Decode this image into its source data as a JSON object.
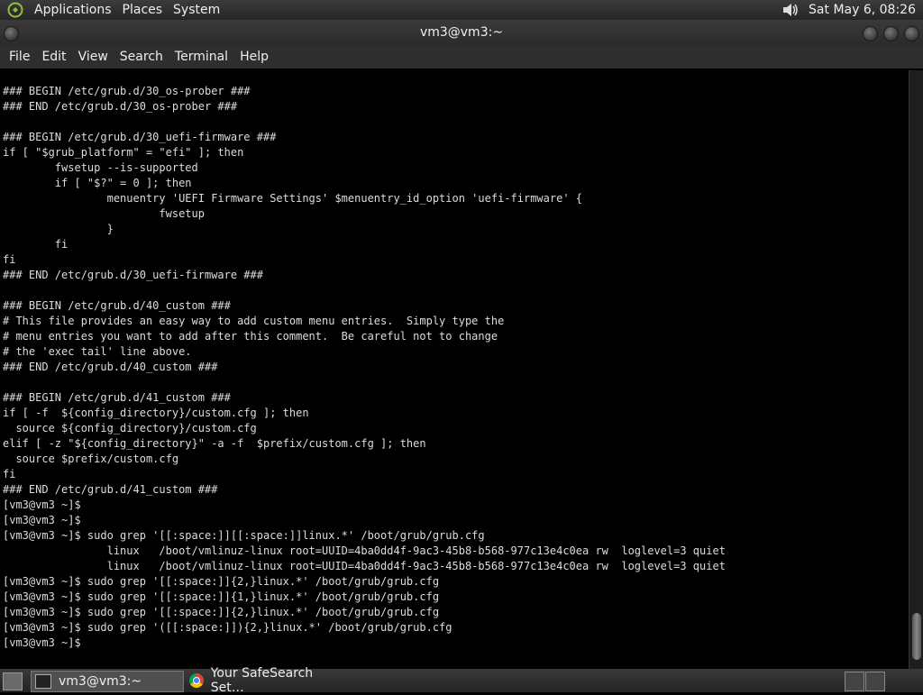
{
  "top_panel": {
    "menus": [
      "Applications",
      "Places",
      "System"
    ],
    "clock": "Sat May  6, 08:26"
  },
  "window": {
    "title": "vm3@vm3:~"
  },
  "menubar": [
    "File",
    "Edit",
    "View",
    "Search",
    "Terminal",
    "Help"
  ],
  "terminal": {
    "lines": [
      "### BEGIN /etc/grub.d/30_os-prober ###",
      "### END /etc/grub.d/30_os-prober ###",
      "",
      "### BEGIN /etc/grub.d/30_uefi-firmware ###",
      "if [ \"$grub_platform\" = \"efi\" ]; then",
      "        fwsetup --is-supported",
      "        if [ \"$?\" = 0 ]; then",
      "                menuentry 'UEFI Firmware Settings' $menuentry_id_option 'uefi-firmware' {",
      "                        fwsetup",
      "                }",
      "        fi",
      "fi",
      "### END /etc/grub.d/30_uefi-firmware ###",
      "",
      "### BEGIN /etc/grub.d/40_custom ###",
      "# This file provides an easy way to add custom menu entries.  Simply type the",
      "# menu entries you want to add after this comment.  Be careful not to change",
      "# the 'exec tail' line above.",
      "### END /etc/grub.d/40_custom ###",
      "",
      "### BEGIN /etc/grub.d/41_custom ###",
      "if [ -f  ${config_directory}/custom.cfg ]; then",
      "  source ${config_directory}/custom.cfg",
      "elif [ -z \"${config_directory}\" -a -f  $prefix/custom.cfg ]; then",
      "  source $prefix/custom.cfg",
      "fi",
      "### END /etc/grub.d/41_custom ###",
      "[vm3@vm3 ~]$",
      "[vm3@vm3 ~]$",
      "[vm3@vm3 ~]$ sudo grep '[[:space:]][[:space:]]linux.*' /boot/grub/grub.cfg",
      "                linux   /boot/vmlinuz-linux root=UUID=4ba0dd4f-9ac3-45b8-b568-977c13e4c0ea rw  loglevel=3 quiet",
      "                linux   /boot/vmlinuz-linux root=UUID=4ba0dd4f-9ac3-45b8-b568-977c13e4c0ea rw  loglevel=3 quiet",
      "[vm3@vm3 ~]$ sudo grep '[[:space:]]{2,}linux.*' /boot/grub/grub.cfg",
      "[vm3@vm3 ~]$ sudo grep '[[:space:]]{1,}linux.*' /boot/grub/grub.cfg",
      "[vm3@vm3 ~]$ sudo grep '[[:space:]]{2,}linux.*' /boot/grub/grub.cfg",
      "[vm3@vm3 ~]$ sudo grep '([[:space:]]){2,}linux.*' /boot/grub/grub.cfg",
      "[vm3@vm3 ~]$"
    ]
  },
  "taskbar": {
    "tasks": [
      "vm3@vm3:~",
      "Your SafeSearch Set…"
    ]
  },
  "icons": {
    "logo": "distro-logo-icon",
    "volume": "volume-icon",
    "terminal": "terminal-icon",
    "browser": "chrome-icon"
  }
}
